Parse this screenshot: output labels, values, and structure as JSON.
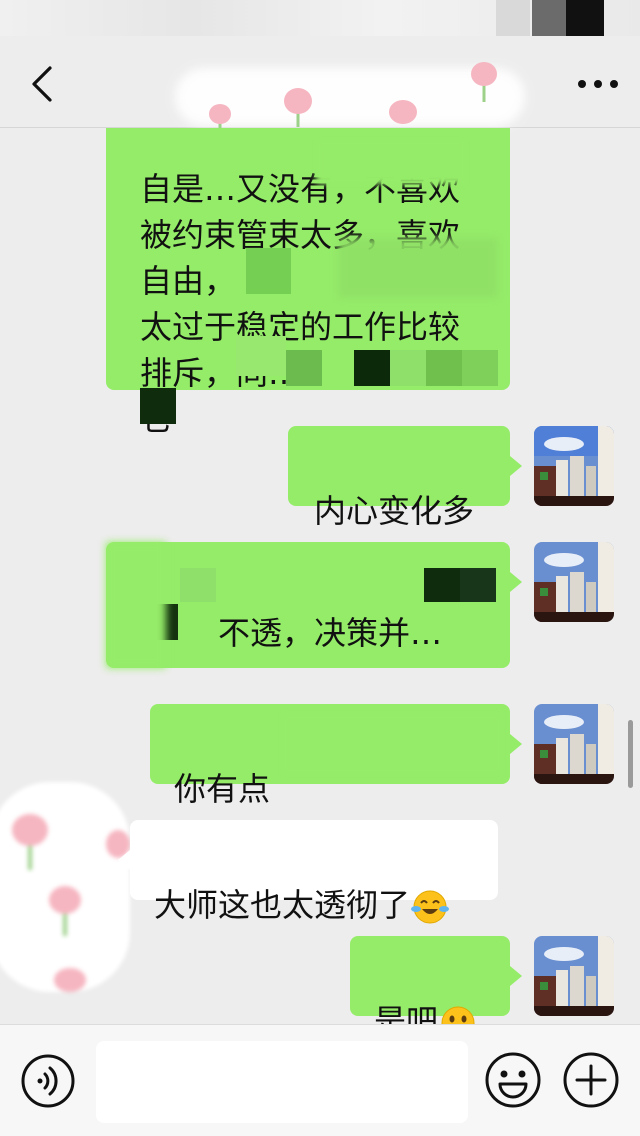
{
  "contact_name": "",
  "messages": [
    {
      "side": "right",
      "type": "text",
      "text": "自是…又没有，不喜欢\n被约束管束太多，喜欢\n自由，\n太过于稳定的工作比较\n排斥，同…\n它"
    },
    {
      "side": "right",
      "type": "text",
      "text": "内心变化多"
    },
    {
      "side": "right",
      "type": "text",
      "text": "不透，决策并…"
    },
    {
      "side": "right",
      "type": "text",
      "text": "你有点"
    },
    {
      "side": "left",
      "type": "text",
      "text": "大师这也太透彻了",
      "emoji": "tears-of-joy-emoji"
    },
    {
      "side": "right",
      "type": "text",
      "text": "是吧",
      "emoji": "smiley-emoji"
    }
  ],
  "input": {
    "value": "",
    "placeholder": ""
  },
  "colors": {
    "sent_bubble": "#95ec69",
    "received_bubble": "#ffffff",
    "background": "#ededed"
  },
  "icons": {
    "back": "chevron-left-icon",
    "more": "more-dots-icon",
    "voice": "voice-icon",
    "emoji": "emoji-icon",
    "plus": "plus-icon"
  }
}
